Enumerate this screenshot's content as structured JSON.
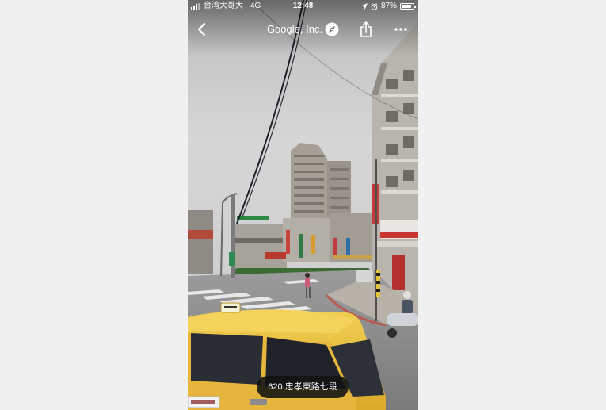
{
  "status_bar": {
    "carrier": "台湾大哥大",
    "network": "4G",
    "time": "12:48",
    "battery": "87%",
    "battery_level": 0.87
  },
  "nav": {
    "title": "Google, Inc.",
    "back_icon": "chevron-left-icon",
    "compass_icon": "compass-icon",
    "share_icon": "share-icon",
    "more_icon": "more-icon"
  },
  "street_view": {
    "location_caption": "620 忠孝東路七段"
  },
  "colors": {
    "status_text": "#ffffff",
    "caption_background": "#121212",
    "taxi_yellow": "#e9c23a"
  }
}
